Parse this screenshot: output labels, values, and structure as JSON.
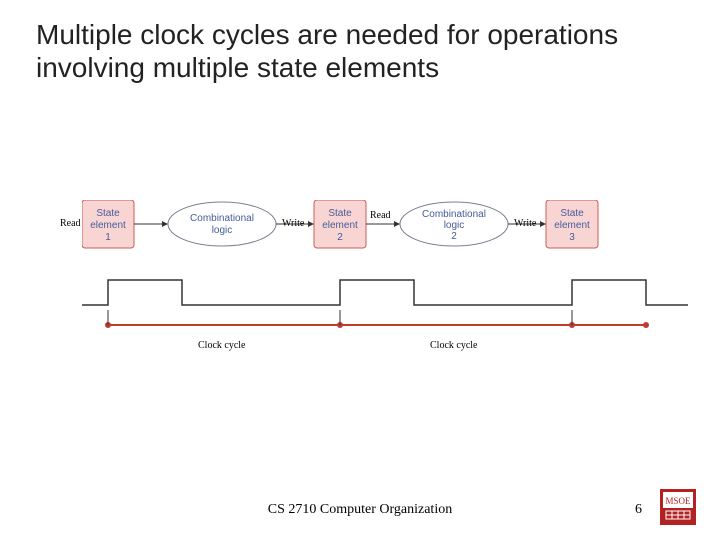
{
  "title": "Multiple clock cycles are needed for operations involving multiple state elements",
  "diagram": {
    "state1": "State\nelement\n1",
    "comb1": "Combinational\nlogic",
    "state2": "State\nelement\n2",
    "comb2": "Combinational\nlogic\n2",
    "state3": "State\nelement\n3",
    "read1": "Read",
    "write1": "Write",
    "read2": "Read",
    "write2": "Write",
    "cycle1": "Clock cycle",
    "cycle2": "Clock cycle"
  },
  "footer": "CS 2710 Computer Organization",
  "page": "6",
  "logo": "MSOE",
  "colors": {
    "state_box": "#f8d5d2",
    "state_border": "#c75d5a",
    "comb_fill": "#ffffff",
    "comb_border": "#7a8098",
    "axis": "#333333",
    "tick": "#bf3a2f",
    "label": "#465b99"
  }
}
